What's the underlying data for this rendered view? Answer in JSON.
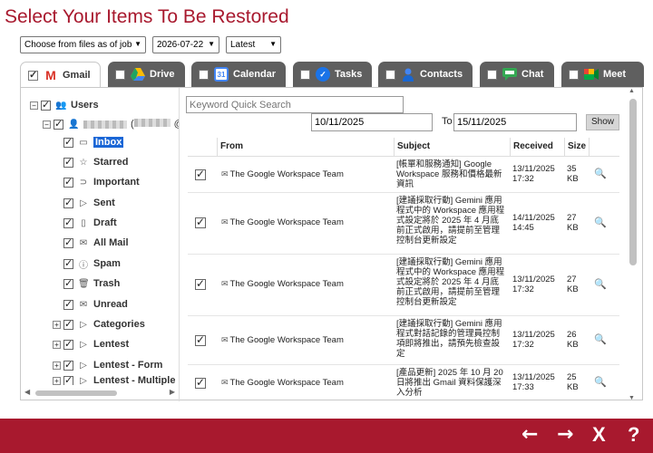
{
  "title": "Select Your Items To Be Restored",
  "controls": {
    "source": "Choose from files as of job",
    "date": "2026-07-22",
    "version": "Latest"
  },
  "tabs": [
    {
      "label": "Gmail",
      "checked": true,
      "active": true,
      "icon": "gmail-icon"
    },
    {
      "label": "Drive",
      "checked": false,
      "active": false,
      "icon": "drive-icon"
    },
    {
      "label": "Calendar",
      "checked": false,
      "active": false,
      "icon": "calendar-icon"
    },
    {
      "label": "Tasks",
      "checked": false,
      "active": false,
      "icon": "tasks-icon"
    },
    {
      "label": "Contacts",
      "checked": false,
      "active": false,
      "icon": "contacts-icon"
    },
    {
      "label": "Chat",
      "checked": false,
      "active": false,
      "icon": "chat-icon"
    },
    {
      "label": "Meet",
      "checked": false,
      "active": false,
      "icon": "meet-icon"
    }
  ],
  "tree": {
    "root": "Users",
    "user_suffix": "@a",
    "folders": [
      {
        "label": "Inbox",
        "icon": "inbox-icon",
        "selected": true
      },
      {
        "label": "Starred",
        "icon": "star-icon"
      },
      {
        "label": "Important",
        "icon": "important-icon"
      },
      {
        "label": "Sent",
        "icon": "sent-icon"
      },
      {
        "label": "Draft",
        "icon": "draft-icon"
      },
      {
        "label": "All Mail",
        "icon": "all-mail-icon"
      },
      {
        "label": "Spam",
        "icon": "spam-icon"
      },
      {
        "label": "Trash",
        "icon": "trash-icon"
      },
      {
        "label": "Unread",
        "icon": "unread-icon"
      },
      {
        "label": "Categories",
        "icon": "label-icon",
        "expandable": true
      },
      {
        "label": "Lentest",
        "icon": "label-icon",
        "expandable": true
      },
      {
        "label": "Lentest - Form",
        "icon": "label-icon",
        "expandable": true
      },
      {
        "label": "Lentest - Multiple",
        "icon": "label-icon",
        "expandable": true
      }
    ]
  },
  "filters": {
    "keyword_placeholder": "Keyword Quick Search",
    "from_date": "10/11/2025",
    "to_label": "To",
    "to_date": "15/11/2025",
    "show_label": "Show"
  },
  "table": {
    "headers": {
      "from": "From",
      "subject": "Subject",
      "received": "Received",
      "size": "Size"
    },
    "rows": [
      {
        "from": "The Google Workspace Team",
        "subject": "[帳單和服務通知] Google Workspace 服務和價格最新資訊",
        "received": "13/11/2025 17:32",
        "size": "35 KB"
      },
      {
        "from": "The Google Workspace Team",
        "subject": "[建議採取行動] Gemini 應用程式中的 Workspace 應用程式設定將於 2025 年 4 月底前正式啟用，請提前至管理控制台更新設定",
        "received": "14/11/2025 14:45",
        "size": "27 KB"
      },
      {
        "from": "The Google Workspace Team",
        "subject": "[建議採取行動] Gemini 應用程式中的 Workspace 應用程式設定將於 2025 年 4 月底前正式啟用，請提前至管理控制台更新設定",
        "received": "13/11/2025 17:32",
        "size": "27 KB"
      },
      {
        "from": "The Google Workspace Team",
        "subject": "[建議採取行動] Gemini 應用程式對話記錄的管理員控制項即將推出，請預先檢查設定",
        "received": "13/11/2025 17:32",
        "size": "26 KB"
      },
      {
        "from": "The Google Workspace Team",
        "subject": "[產品更新] 2025 年 10 月 20 日將推出 Gmail 資料保護深入分析",
        "received": "13/11/2025 17:33",
        "size": "25 KB"
      }
    ]
  },
  "footer": {
    "back": "←",
    "forward": "→",
    "close": "X",
    "help": "?"
  },
  "colors": {
    "brand": "#a8192e",
    "tab_inactive": "#5f5f5f",
    "selection": "#1a66d6"
  }
}
